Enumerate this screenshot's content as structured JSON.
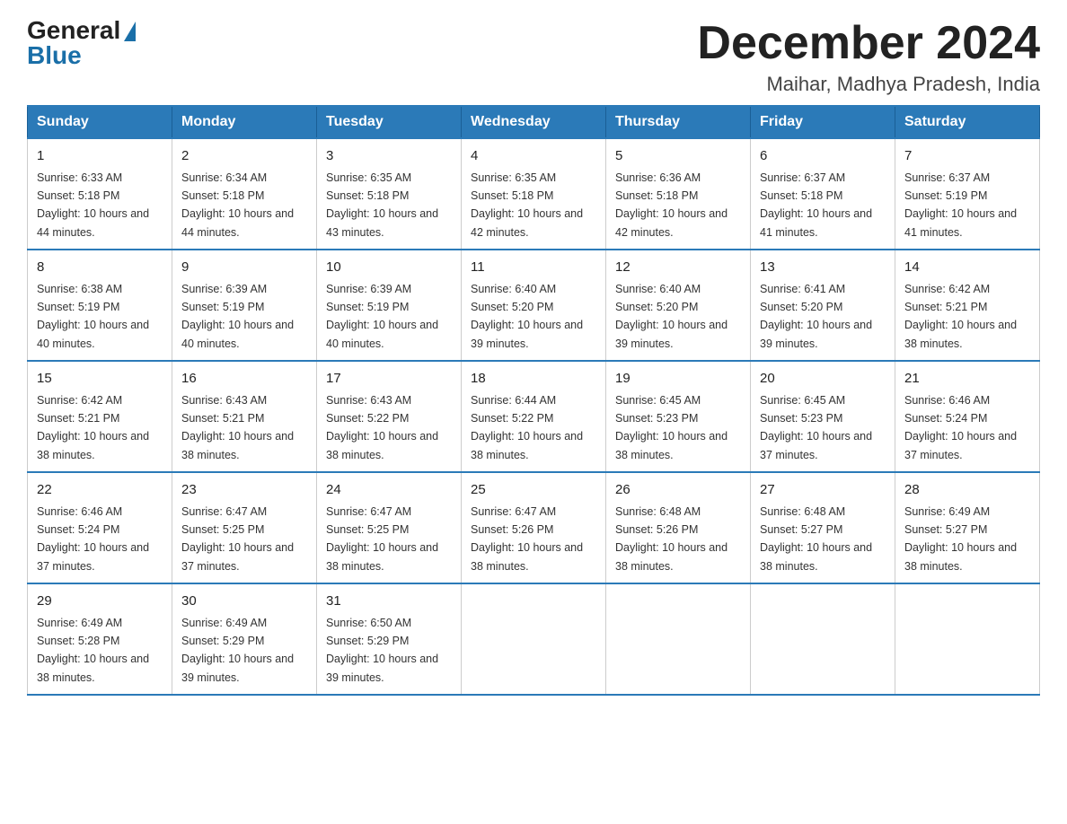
{
  "header": {
    "logo_general": "General",
    "logo_blue": "Blue",
    "month": "December 2024",
    "location": "Maihar, Madhya Pradesh, India"
  },
  "columns": [
    "Sunday",
    "Monday",
    "Tuesday",
    "Wednesday",
    "Thursday",
    "Friday",
    "Saturday"
  ],
  "weeks": [
    [
      {
        "day": "1",
        "sunrise": "6:33 AM",
        "sunset": "5:18 PM",
        "daylight": "10 hours and 44 minutes."
      },
      {
        "day": "2",
        "sunrise": "6:34 AM",
        "sunset": "5:18 PM",
        "daylight": "10 hours and 44 minutes."
      },
      {
        "day": "3",
        "sunrise": "6:35 AM",
        "sunset": "5:18 PM",
        "daylight": "10 hours and 43 minutes."
      },
      {
        "day": "4",
        "sunrise": "6:35 AM",
        "sunset": "5:18 PM",
        "daylight": "10 hours and 42 minutes."
      },
      {
        "day": "5",
        "sunrise": "6:36 AM",
        "sunset": "5:18 PM",
        "daylight": "10 hours and 42 minutes."
      },
      {
        "day": "6",
        "sunrise": "6:37 AM",
        "sunset": "5:18 PM",
        "daylight": "10 hours and 41 minutes."
      },
      {
        "day": "7",
        "sunrise": "6:37 AM",
        "sunset": "5:19 PM",
        "daylight": "10 hours and 41 minutes."
      }
    ],
    [
      {
        "day": "8",
        "sunrise": "6:38 AM",
        "sunset": "5:19 PM",
        "daylight": "10 hours and 40 minutes."
      },
      {
        "day": "9",
        "sunrise": "6:39 AM",
        "sunset": "5:19 PM",
        "daylight": "10 hours and 40 minutes."
      },
      {
        "day": "10",
        "sunrise": "6:39 AM",
        "sunset": "5:19 PM",
        "daylight": "10 hours and 40 minutes."
      },
      {
        "day": "11",
        "sunrise": "6:40 AM",
        "sunset": "5:20 PM",
        "daylight": "10 hours and 39 minutes."
      },
      {
        "day": "12",
        "sunrise": "6:40 AM",
        "sunset": "5:20 PM",
        "daylight": "10 hours and 39 minutes."
      },
      {
        "day": "13",
        "sunrise": "6:41 AM",
        "sunset": "5:20 PM",
        "daylight": "10 hours and 39 minutes."
      },
      {
        "day": "14",
        "sunrise": "6:42 AM",
        "sunset": "5:21 PM",
        "daylight": "10 hours and 38 minutes."
      }
    ],
    [
      {
        "day": "15",
        "sunrise": "6:42 AM",
        "sunset": "5:21 PM",
        "daylight": "10 hours and 38 minutes."
      },
      {
        "day": "16",
        "sunrise": "6:43 AM",
        "sunset": "5:21 PM",
        "daylight": "10 hours and 38 minutes."
      },
      {
        "day": "17",
        "sunrise": "6:43 AM",
        "sunset": "5:22 PM",
        "daylight": "10 hours and 38 minutes."
      },
      {
        "day": "18",
        "sunrise": "6:44 AM",
        "sunset": "5:22 PM",
        "daylight": "10 hours and 38 minutes."
      },
      {
        "day": "19",
        "sunrise": "6:45 AM",
        "sunset": "5:23 PM",
        "daylight": "10 hours and 38 minutes."
      },
      {
        "day": "20",
        "sunrise": "6:45 AM",
        "sunset": "5:23 PM",
        "daylight": "10 hours and 37 minutes."
      },
      {
        "day": "21",
        "sunrise": "6:46 AM",
        "sunset": "5:24 PM",
        "daylight": "10 hours and 37 minutes."
      }
    ],
    [
      {
        "day": "22",
        "sunrise": "6:46 AM",
        "sunset": "5:24 PM",
        "daylight": "10 hours and 37 minutes."
      },
      {
        "day": "23",
        "sunrise": "6:47 AM",
        "sunset": "5:25 PM",
        "daylight": "10 hours and 37 minutes."
      },
      {
        "day": "24",
        "sunrise": "6:47 AM",
        "sunset": "5:25 PM",
        "daylight": "10 hours and 38 minutes."
      },
      {
        "day": "25",
        "sunrise": "6:47 AM",
        "sunset": "5:26 PM",
        "daylight": "10 hours and 38 minutes."
      },
      {
        "day": "26",
        "sunrise": "6:48 AM",
        "sunset": "5:26 PM",
        "daylight": "10 hours and 38 minutes."
      },
      {
        "day": "27",
        "sunrise": "6:48 AM",
        "sunset": "5:27 PM",
        "daylight": "10 hours and 38 minutes."
      },
      {
        "day": "28",
        "sunrise": "6:49 AM",
        "sunset": "5:27 PM",
        "daylight": "10 hours and 38 minutes."
      }
    ],
    [
      {
        "day": "29",
        "sunrise": "6:49 AM",
        "sunset": "5:28 PM",
        "daylight": "10 hours and 38 minutes."
      },
      {
        "day": "30",
        "sunrise": "6:49 AM",
        "sunset": "5:29 PM",
        "daylight": "10 hours and 39 minutes."
      },
      {
        "day": "31",
        "sunrise": "6:50 AM",
        "sunset": "5:29 PM",
        "daylight": "10 hours and 39 minutes."
      },
      null,
      null,
      null,
      null
    ]
  ],
  "labels": {
    "sunrise": "Sunrise:",
    "sunset": "Sunset:",
    "daylight": "Daylight:"
  }
}
